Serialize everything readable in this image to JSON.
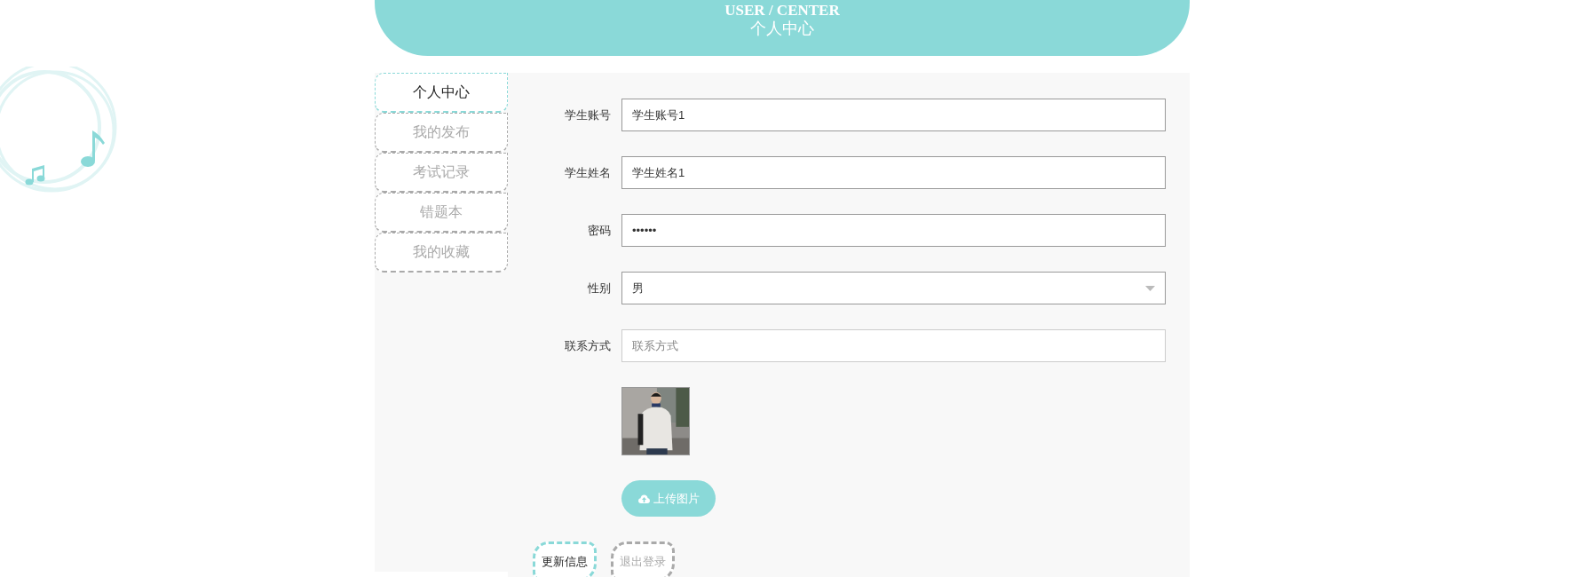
{
  "header": {
    "subtitle": "USER / CENTER",
    "title": "个人中心"
  },
  "sidebar": {
    "items": [
      {
        "label": "个人中心",
        "selected": true
      },
      {
        "label": "我的发布",
        "selected": false
      },
      {
        "label": "考试记录",
        "selected": false
      },
      {
        "label": "错题本",
        "selected": false
      },
      {
        "label": "我的收藏",
        "selected": false
      }
    ]
  },
  "form": {
    "fields": [
      {
        "kind": "text",
        "label": "学生账号",
        "value": "学生账号1"
      },
      {
        "kind": "text",
        "label": "学生姓名",
        "value": "学生姓名1"
      },
      {
        "kind": "password",
        "label": "密码",
        "value": "••••••"
      },
      {
        "kind": "select",
        "label": "性别",
        "value": "男"
      },
      {
        "kind": "text",
        "label": "联系方式",
        "placeholder": "联系方式"
      }
    ],
    "upload_button": "上传图片",
    "actions": [
      {
        "kind": "primary",
        "label": "更新信息"
      },
      {
        "kind": "secondary",
        "label": "退出登录"
      }
    ]
  }
}
